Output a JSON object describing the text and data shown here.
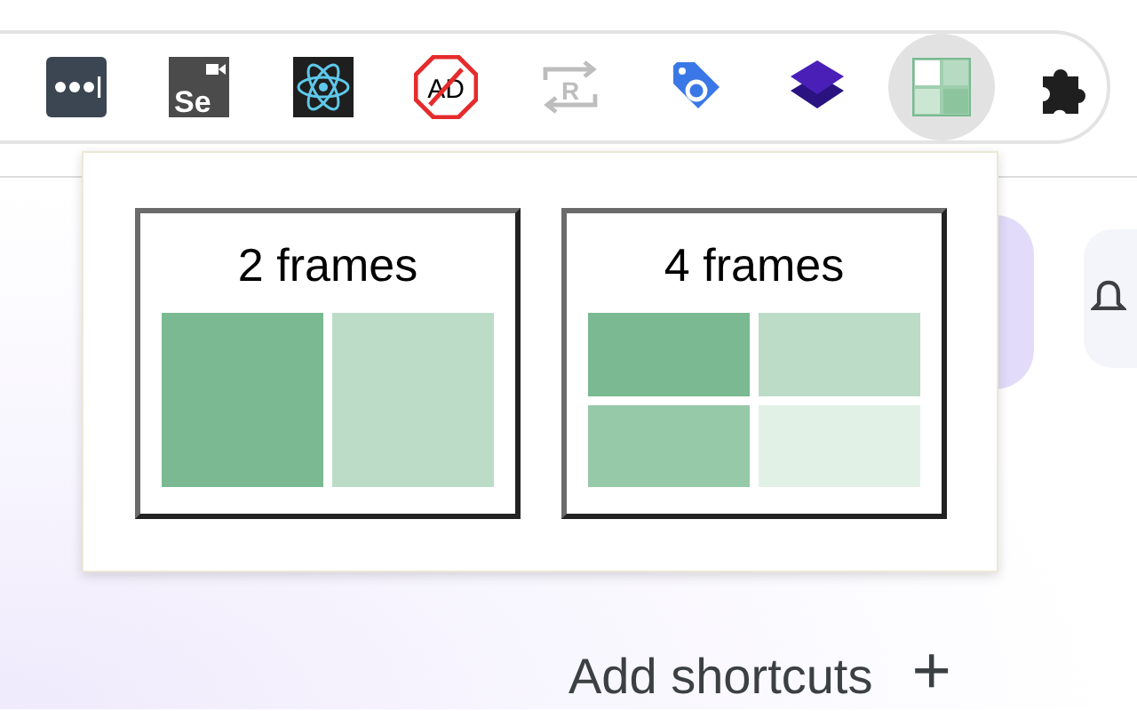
{
  "toolbar": {
    "extensions": [
      {
        "kind": "password",
        "selected": false
      },
      {
        "kind": "selenium",
        "label": "Se",
        "selected": false
      },
      {
        "kind": "atom",
        "selected": false
      },
      {
        "kind": "adblock",
        "label": "AD",
        "selected": false
      },
      {
        "kind": "redirect",
        "label": "R",
        "selected": false
      },
      {
        "kind": "tag",
        "selected": false
      },
      {
        "kind": "layers",
        "selected": false
      },
      {
        "kind": "grid",
        "selected": true
      },
      {
        "kind": "puzzle",
        "selected": false
      }
    ]
  },
  "popup": {
    "options": [
      {
        "title": "2 frames",
        "frames": [
          {
            "color": "#7ab991"
          },
          {
            "color": "#bcdcc8"
          }
        ]
      },
      {
        "title": "4 frames",
        "frames": [
          {
            "color": "#7ab991"
          },
          {
            "color": "#bcdcc8"
          },
          {
            "color": "#96c9a7"
          },
          {
            "color": "#e2f1e6"
          }
        ]
      }
    ]
  },
  "page": {
    "shortcuts_label": "Add shortcuts",
    "add_icon": "+"
  }
}
